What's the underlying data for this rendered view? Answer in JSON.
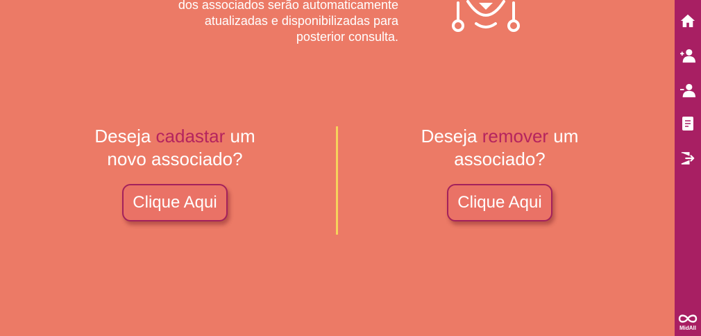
{
  "intro": {
    "lines": [
      "dos associados serão automaticamente",
      "atualizadas e disponibilizadas para",
      "posterior consulta."
    ]
  },
  "register": {
    "prefix": "Deseja ",
    "highlight": "cadastar",
    "suffix_line1": " um",
    "line2": "novo associado?",
    "button_label": "Clique Aqui"
  },
  "remove": {
    "prefix": "Deseja ",
    "highlight": "remover",
    "suffix_line1": " um",
    "line2": "associado?",
    "button_label": "Clique Aqui"
  },
  "sidebar": {
    "items": [
      {
        "icon": "home-icon"
      },
      {
        "icon": "add-user-icon"
      },
      {
        "icon": "remove-user-icon"
      },
      {
        "icon": "document-icon"
      },
      {
        "icon": "logout-icon"
      }
    ],
    "logo_text": "MidAll"
  },
  "colors": {
    "background": "#ec7a66",
    "sidebar": "#a81f63",
    "highlight": "#b5245e",
    "divider": "#f6d35c",
    "button_border": "#a3215c"
  }
}
